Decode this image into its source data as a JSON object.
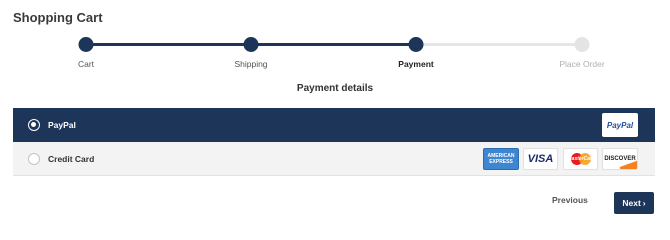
{
  "header": {
    "title": "Shopping Cart"
  },
  "stepper": {
    "steps": [
      {
        "label": "Cart",
        "state": "done"
      },
      {
        "label": "Shipping",
        "state": "done"
      },
      {
        "label": "Payment",
        "state": "current"
      },
      {
        "label": "Place Order",
        "state": "todo"
      }
    ]
  },
  "payment": {
    "title": "Payment details",
    "methods": [
      {
        "name": "PayPal",
        "selected": true,
        "logos": [
          "PayPal"
        ]
      },
      {
        "name": "Credit Card",
        "selected": false,
        "logos": [
          "AMERICAN EXPRESS",
          "VISA",
          "MasterCard",
          "DISCOVER"
        ]
      }
    ]
  },
  "actions": {
    "previous": "Previous",
    "next": "Next",
    "next_icon": "›"
  },
  "colors": {
    "primary": "#1d3559",
    "inactive": "#e4e4e4"
  }
}
